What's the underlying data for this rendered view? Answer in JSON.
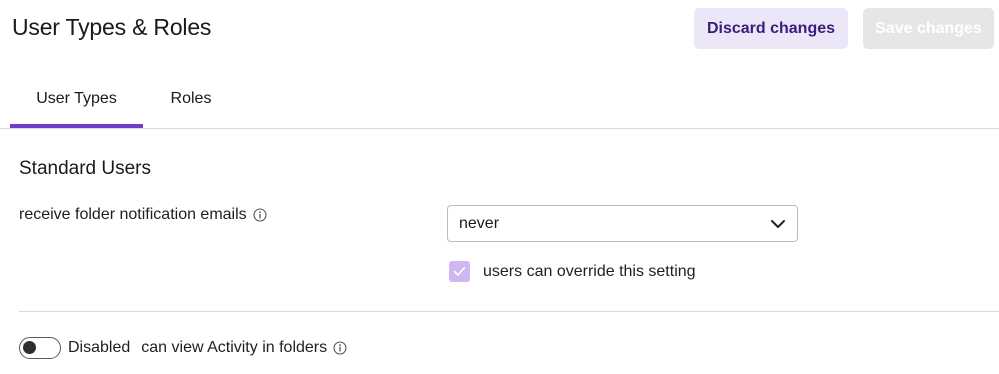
{
  "header": {
    "title": "User Types & Roles",
    "discard_label": "Discard changes",
    "save_label": "Save changes"
  },
  "tabs": [
    {
      "label": "User Types",
      "active": true
    },
    {
      "label": "Roles",
      "active": false
    }
  ],
  "section": {
    "title": "Standard Users",
    "folder_notification": {
      "label": "receive folder notification emails",
      "icon": "info-icon",
      "selected_value": "never",
      "override_label": "users can override this setting",
      "override_checked": true
    },
    "activity": {
      "toggle_status": "Disabled",
      "toggle_on": false,
      "label": "can view Activity in folders",
      "icon": "info-icon"
    }
  },
  "colors": {
    "accent": "#6f3cc8",
    "discard_bg": "#ece6f9",
    "discard_text": "#3a1d7a",
    "save_bg": "#e6e6e6",
    "checkbox_bg": "#cfb8f2"
  }
}
